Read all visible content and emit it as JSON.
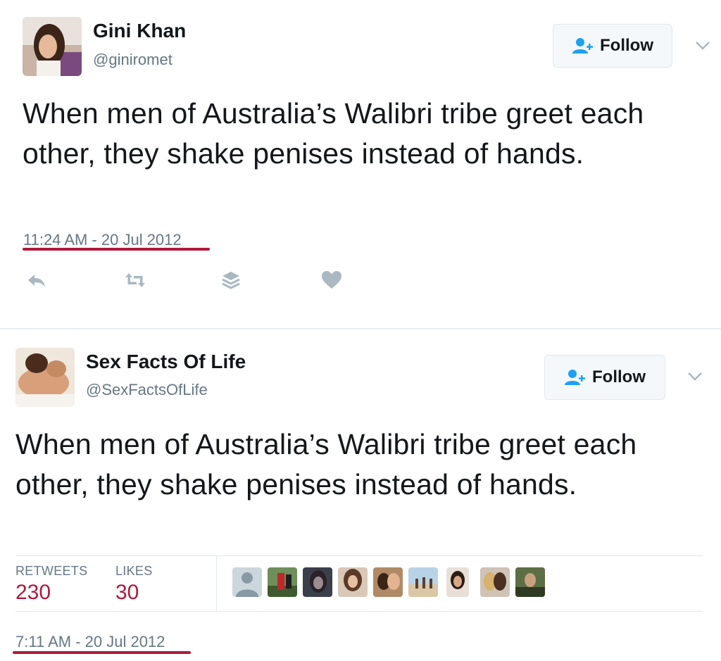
{
  "tweets": [
    {
      "name": "Gini Khan",
      "handle": "@giniromet",
      "follow_label": "Follow",
      "text": "When men of Australia’s Walibri tribe greet each other, they shake penises instead of hands.",
      "timestamp": "11:24 AM - 20 Jul 2012",
      "actions": [
        "reply-icon",
        "retweet-icon",
        "stack-icon",
        "heart-icon"
      ]
    },
    {
      "name": "Sex Facts Of Life",
      "handle": "@SexFactsOfLife",
      "follow_label": "Follow",
      "text": "When men of Australia’s Walibri tribe greet each other, they shake penises instead of hands.",
      "timestamp": "7:11 AM - 20 Jul 2012",
      "stats": {
        "retweets_label": "RETWEETS",
        "retweets_value": "230",
        "likes_label": "LIKES",
        "likes_value": "30"
      },
      "liker_avatar_count": 10
    }
  ],
  "colors": {
    "accent_underline": "#b0193b",
    "stat_value": "#b0193b",
    "follow_icon": "#1da1f2",
    "muted_text": "#657786",
    "action_icon": "#aab8c2"
  }
}
